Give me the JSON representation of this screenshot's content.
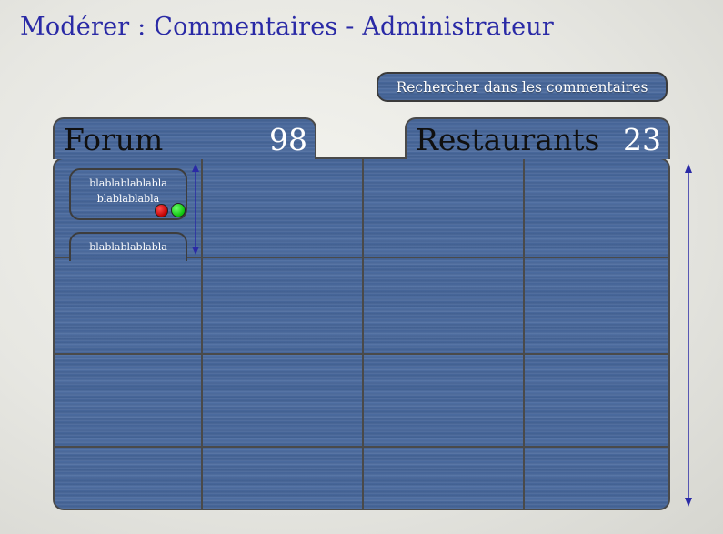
{
  "page": {
    "title": "Modérer : Commentaires - Administrateur"
  },
  "toolbar": {
    "search_label": "Rechercher dans les commentaires"
  },
  "tabs": [
    {
      "label": "Forum",
      "count": "98"
    },
    {
      "label": "Restaurants",
      "count": "23"
    }
  ],
  "comments": [
    {
      "line1": "blablablablabla",
      "line2": "blablablabla"
    },
    {
      "line1": "blablablablabla"
    }
  ],
  "colors": {
    "title": "#2a2aa6",
    "panel": "#4a6a9e",
    "arrow": "#2a2aa6",
    "approve": "#0cc20c",
    "reject": "#c00000"
  },
  "icons": [
    "reject-dot-icon",
    "approve-dot-icon",
    "vertical-scroll-arrow-icon"
  ]
}
